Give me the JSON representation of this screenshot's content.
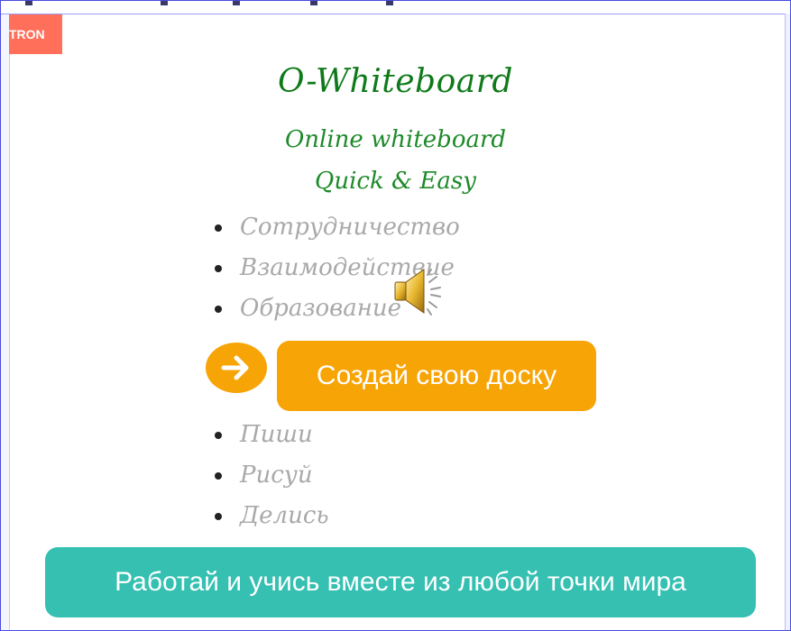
{
  "badge": {
    "text": "TRON",
    "color": "#ff6f5a"
  },
  "hero": {
    "title": "O-Whiteboard",
    "subtitle_line1": "Online whiteboard",
    "subtitle_line2": "Quick & Easy"
  },
  "features_top": [
    {
      "label": "Сотрудничество"
    },
    {
      "label": "Взаимодействие"
    },
    {
      "label": "Образование"
    }
  ],
  "features_bottom": [
    {
      "label": "Пиши"
    },
    {
      "label": "Рисуй"
    },
    {
      "label": "Делись"
    }
  ],
  "cta": {
    "arrow_icon": "arrow-right-icon",
    "button_label": "Создай свою доску",
    "color": "#f7a407"
  },
  "banner": {
    "label": "Работай и учись вместе из любой точки мира",
    "color": "#35c0b2"
  },
  "media": {
    "icon": "speaker-icon"
  }
}
